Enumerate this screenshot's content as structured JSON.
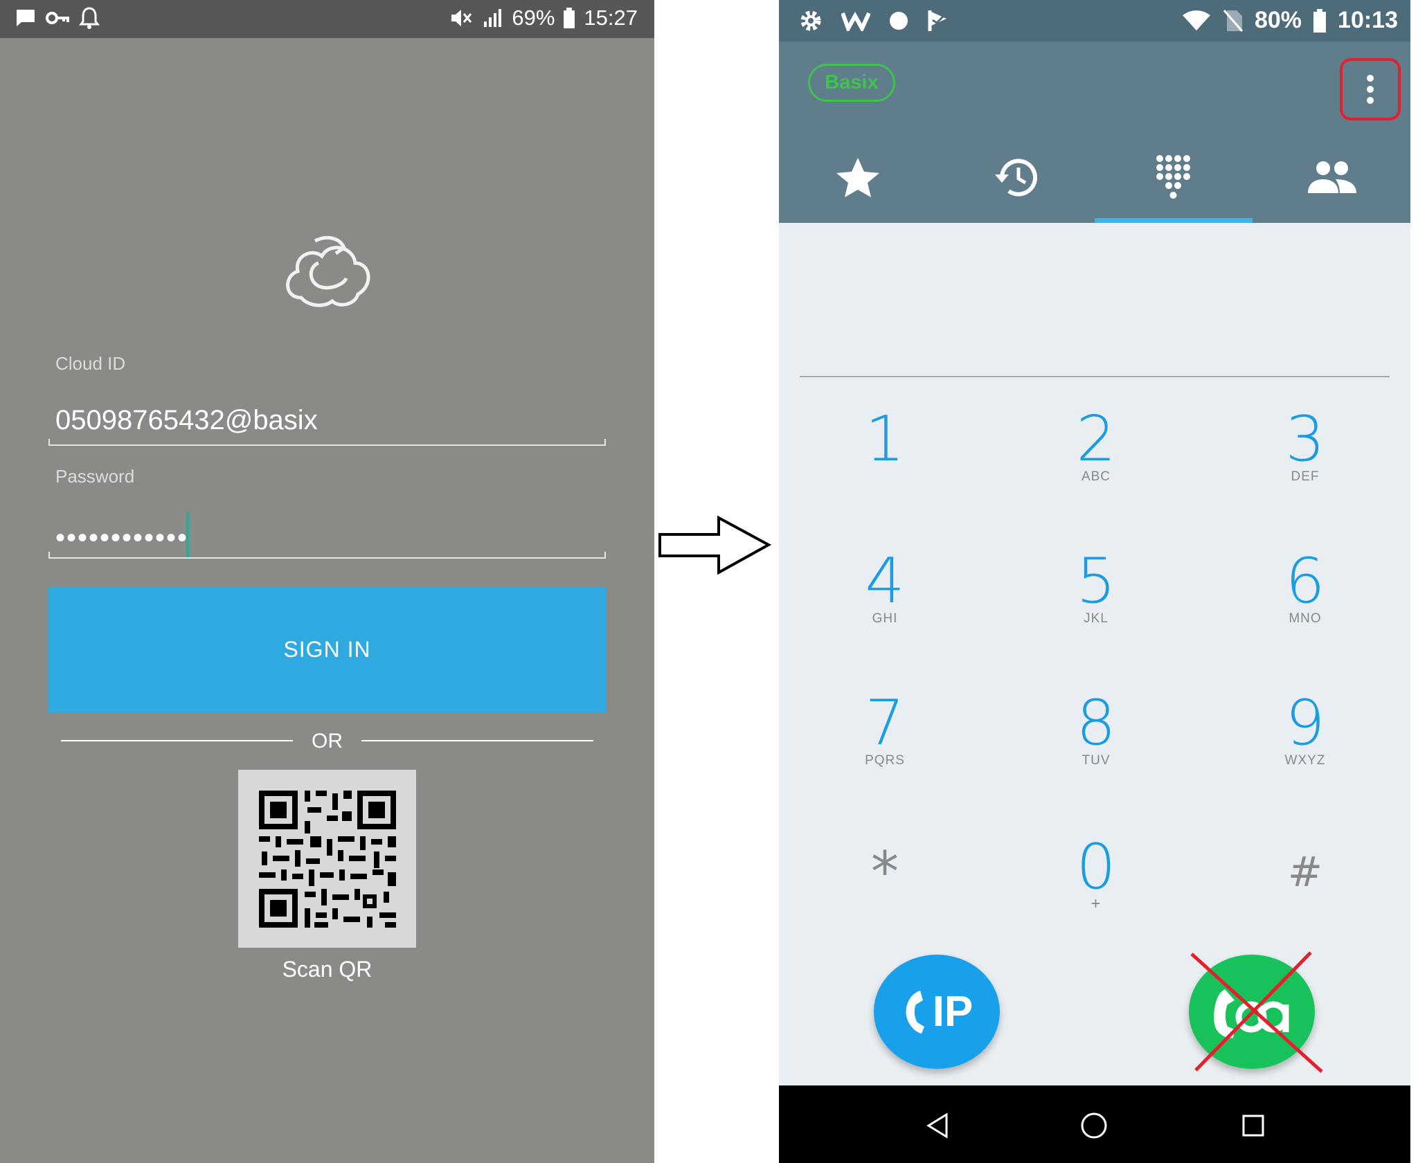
{
  "left_screen": {
    "status_bar": {
      "icons_left": [
        "message-icon",
        "key-icon",
        "bell-icon"
      ],
      "icons_right": [
        "mute-icon",
        "signal-icon",
        "battery-icon"
      ],
      "battery": "69%",
      "time": "15:27"
    },
    "logo_icon": "phone-cloud-logo",
    "cloud_id": {
      "label": "Cloud ID",
      "value": "05098765432@basix"
    },
    "password": {
      "label": "Password",
      "masked_value": "••••••••••••"
    },
    "sign_in_label": "SIGN IN",
    "or_label": "OR",
    "qr": {
      "icon": "qr-code-icon",
      "label": "Scan QR"
    }
  },
  "arrow_icon": "right-arrow-icon",
  "right_screen": {
    "status_bar": {
      "icons_left": [
        "gear-icon",
        "w-app-icon",
        "circle-icon",
        "flag-icon"
      ],
      "icons_right": [
        "wifi-icon",
        "no-sim-icon",
        "battery-icon"
      ],
      "battery": "80%",
      "time": "10:13"
    },
    "account_chip": "Basix",
    "menu_icon": "more-vert-icon",
    "tabs": [
      {
        "name": "favorites",
        "icon": "star-icon"
      },
      {
        "name": "history",
        "icon": "history-icon"
      },
      {
        "name": "dialpad",
        "icon": "dialpad-icon",
        "selected": true
      },
      {
        "name": "contacts",
        "icon": "contacts-icon"
      }
    ],
    "keypad": [
      {
        "digit": "1",
        "letters": ""
      },
      {
        "digit": "2",
        "letters": "ABC"
      },
      {
        "digit": "3",
        "letters": "DEF"
      },
      {
        "digit": "4",
        "letters": "GHI"
      },
      {
        "digit": "5",
        "letters": "JKL"
      },
      {
        "digit": "6",
        "letters": "MNO"
      },
      {
        "digit": "7",
        "letters": "PQRS"
      },
      {
        "digit": "8",
        "letters": "TUV"
      },
      {
        "digit": "9",
        "letters": "WXYZ"
      },
      {
        "digit": "*",
        "letters": ""
      },
      {
        "digit": "0",
        "letters": "+"
      },
      {
        "digit": "#",
        "letters": ""
      }
    ],
    "call_ip_label": "IP",
    "call_gsm": {
      "icon": "gsm-call-icon",
      "crossed_out": true
    },
    "nav": [
      "back-icon",
      "home-icon",
      "recents-icon"
    ],
    "colors": {
      "appbar": "#607d8b",
      "accent": "#1a9de0",
      "chip_green": "#3cc44b",
      "highlight_red": "#e5202e",
      "gsm_green": "#17c25a"
    }
  }
}
